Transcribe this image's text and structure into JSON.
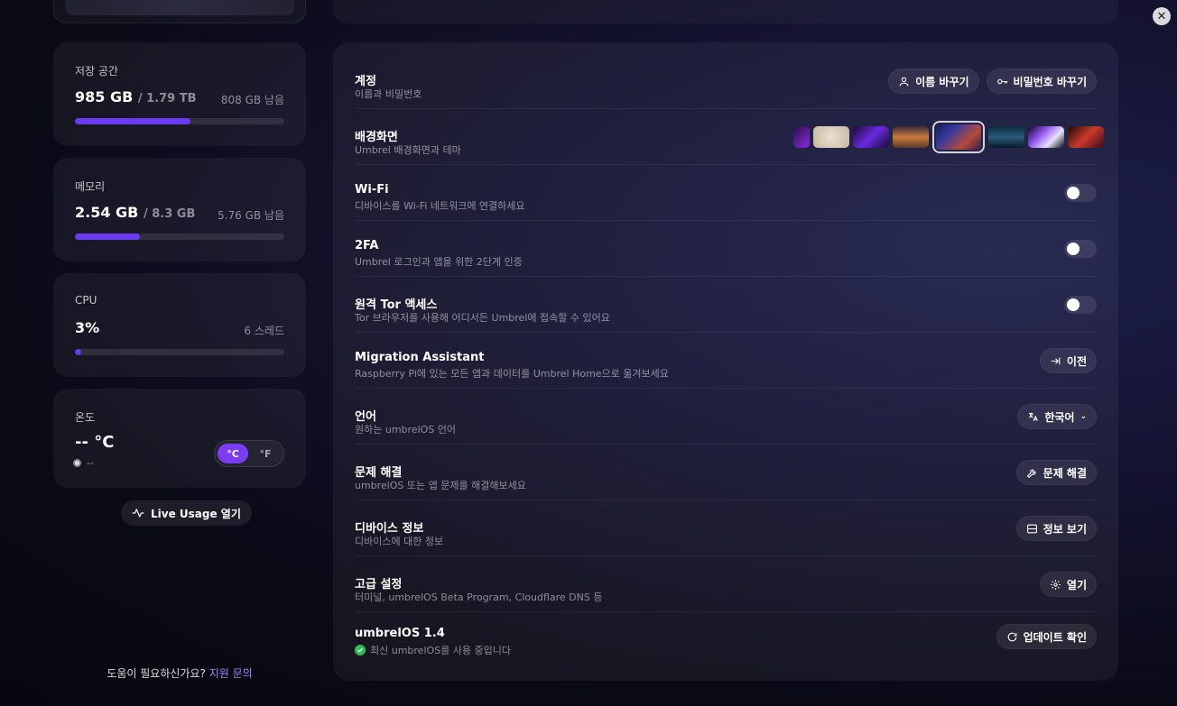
{
  "storage": {
    "label": "저장 공간",
    "used": "985 GB",
    "total": "/ 1.79 TB",
    "remaining": "808 GB 남음",
    "fraction": 0.55
  },
  "memory": {
    "label": "메모리",
    "used": "2.54 GB",
    "total": "/ 8.3 GB",
    "remaining": "5.76 GB 남음",
    "fraction": 0.31
  },
  "cpu": {
    "label": "CPU",
    "used": "3%",
    "threads": "6 스레드",
    "fraction": 0.03
  },
  "temperature": {
    "label": "온도",
    "value": "-- °C",
    "status": "--",
    "unit_c": "°C",
    "unit_f": "°F",
    "selected_unit": "°C"
  },
  "live_usage": {
    "label": "Live Usage 열기",
    "icon": "activity-icon"
  },
  "help": {
    "text": "도움이 필요하신가요?",
    "link": "지원 문의"
  },
  "settings": {
    "account": {
      "title": "계정",
      "desc": "이름과 비밀번호",
      "rename_button": "이름 바꾸기",
      "password_button": "비밀번호 바꾸기"
    },
    "wallpaper": {
      "title": "배경화면",
      "desc": "Umbrel 배경화면과 테마"
    },
    "wifi": {
      "title": "Wi-Fi",
      "desc": "디바이스를 Wi-Fi 네트워크에 연결하세요",
      "enabled": false
    },
    "twofa": {
      "title": "2FA",
      "desc": "Umbrel 로그인과 앱을 위한 2단계 인증",
      "enabled": false
    },
    "tor": {
      "title": "원격 Tor 액세스",
      "desc": "Tor 브라우저를 사용해 어디서든 Umbrel에 접속할 수 있어요",
      "enabled": false
    },
    "migration": {
      "title": "Migration Assistant",
      "desc": "Raspberry Pi에 있는 모든 앱과 데이터를 Umbrel Home으로 옮겨보세요",
      "button": "이전"
    },
    "language": {
      "title": "언어",
      "desc": "원하는 umbrelOS 언어",
      "selected": "한국어"
    },
    "troubleshoot": {
      "title": "문제 해결",
      "desc": "umbrelOS 또는 앱 문제를 해결해보세요",
      "button": "문제 해결"
    },
    "device_info": {
      "title": "디바이스 정보",
      "desc": "디바이스에 대한 정보",
      "button": "정보 보기"
    },
    "advanced": {
      "title": "고급 설정",
      "desc": "터미널, umbrelOS Beta Program, Cloudflare DNS 등",
      "button": "열기"
    },
    "update": {
      "title": "umbrelOS 1.4",
      "desc": "최신 umbrelOS를 사용 중입니다",
      "button": "업데이트 확인"
    }
  },
  "colors": {
    "accent": "#6b3bf2",
    "success": "#2fbf56"
  }
}
